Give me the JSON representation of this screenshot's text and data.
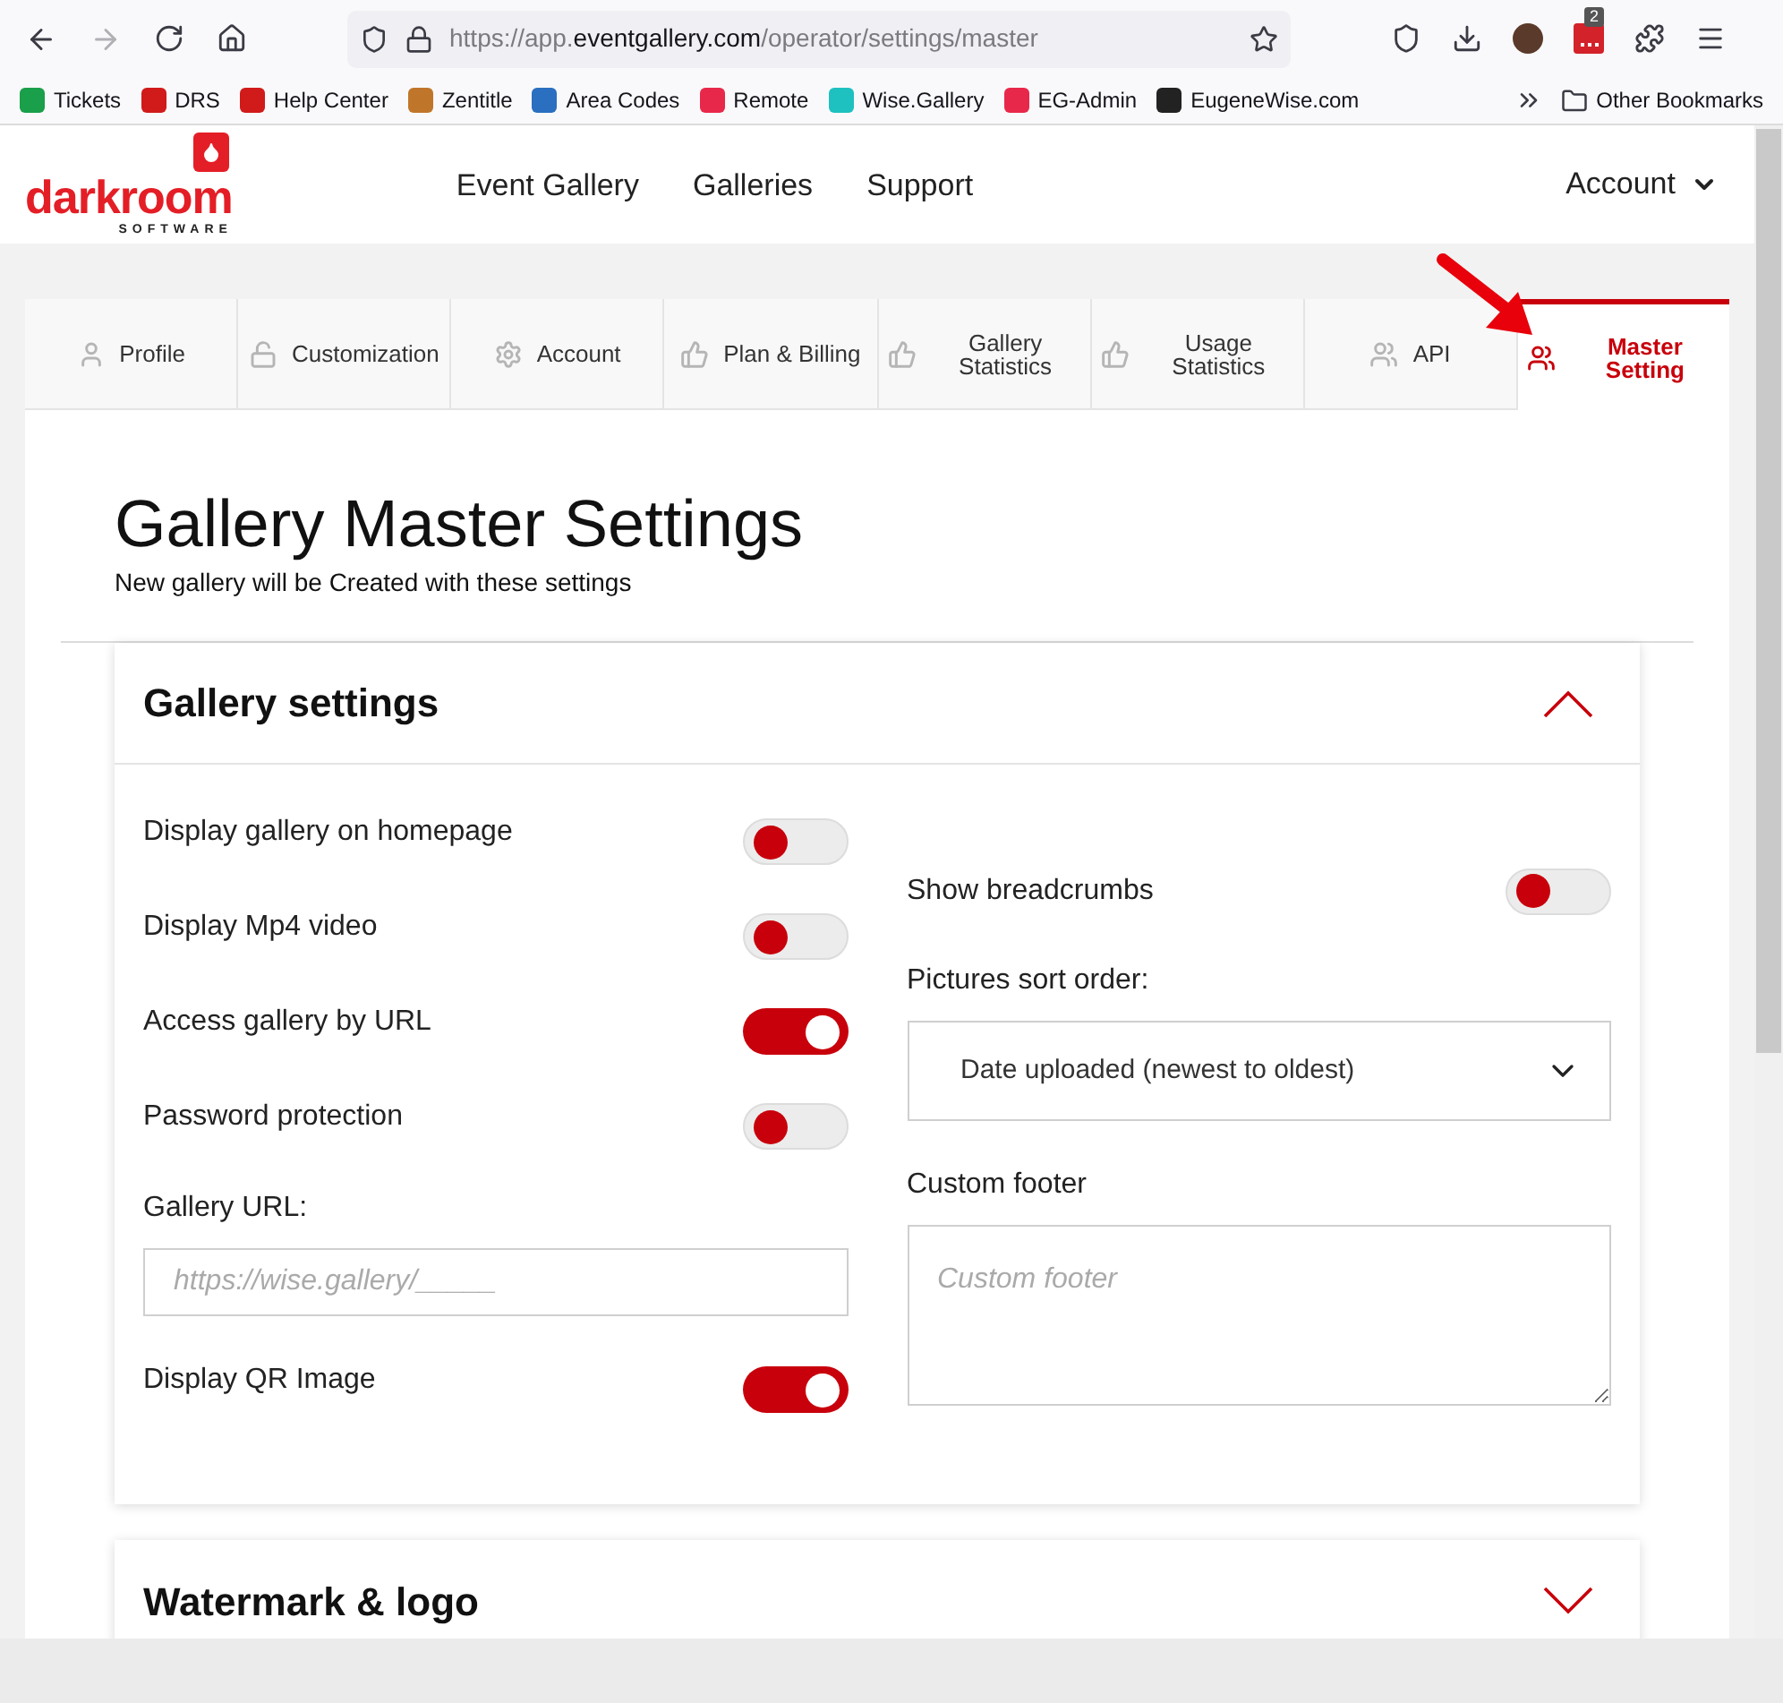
{
  "browser": {
    "back_disabled": false,
    "forward_disabled": true,
    "url_parts": [
      {
        "text": "https://app.",
        "strong": false
      },
      {
        "text": "eventgallery.com",
        "strong": true
      },
      {
        "text": "/operator/settings/master",
        "strong": false
      }
    ],
    "extension_badge": "2",
    "bookmarks": [
      {
        "label": "Tickets",
        "color": "#1a9f4a"
      },
      {
        "label": "DRS",
        "color": "#d11a1a"
      },
      {
        "label": "Help Center",
        "color": "#d11a1a"
      },
      {
        "label": "Zentitle",
        "color": "#c0762a"
      },
      {
        "label": "Area Codes",
        "color": "#2a6fc0"
      },
      {
        "label": "Remote",
        "color": "#e8284a"
      },
      {
        "label": "Wise.Gallery",
        "color": "#1ec0c0"
      },
      {
        "label": "EG-Admin",
        "color": "#e8284a"
      },
      {
        "label": "EugeneWise.com",
        "color": "#222222"
      }
    ],
    "other_bookmarks": "Other Bookmarks"
  },
  "header": {
    "logo_word": "darkroom",
    "logo_sub": "SOFTWARE",
    "nav": [
      "Event Gallery",
      "Galleries",
      "Support"
    ],
    "account": "Account"
  },
  "tabs": [
    {
      "label": "Profile",
      "kind": "user",
      "selected": false
    },
    {
      "label": "Customization",
      "kind": "lock",
      "selected": false
    },
    {
      "label": "Account",
      "kind": "gear",
      "selected": false
    },
    {
      "label": "Plan & Billing",
      "kind": "thumb",
      "selected": false
    },
    {
      "label": "Gallery Statistics",
      "kind": "thumb",
      "selected": false
    },
    {
      "label": "Usage Statistics",
      "kind": "thumb",
      "selected": false
    },
    {
      "label": "API",
      "kind": "group",
      "selected": false
    },
    {
      "label": "Master Setting",
      "kind": "group",
      "selected": true
    }
  ],
  "page": {
    "title": "Gallery Master Settings",
    "subtitle": "New gallery will be Created with these settings"
  },
  "sections": [
    {
      "title": "Gallery settings",
      "expanded": true,
      "left": [
        {
          "kind": "toggle",
          "label": "Display gallery on homepage",
          "on": false
        },
        {
          "kind": "toggle",
          "label": "Display Mp4 video",
          "on": false
        },
        {
          "kind": "toggle",
          "label": "Access gallery by URL",
          "on": true
        },
        {
          "kind": "toggle",
          "label": "Password protection",
          "on": false
        },
        {
          "kind": "input",
          "label": "Gallery URL:",
          "placeholder": "https://wise.gallery/_____"
        },
        {
          "kind": "toggle",
          "label": "Display QR Image",
          "on": true
        }
      ],
      "right": [
        {
          "kind": "toggle",
          "label": "Show breadcrumbs",
          "on": false
        },
        {
          "kind": "select",
          "label": "Pictures sort order:",
          "value": "Date uploaded (newest to oldest)"
        },
        {
          "kind": "textarea",
          "label": "Custom footer",
          "placeholder": "Custom footer"
        }
      ]
    },
    {
      "title": "Watermark & logo",
      "expanded": false
    }
  ]
}
